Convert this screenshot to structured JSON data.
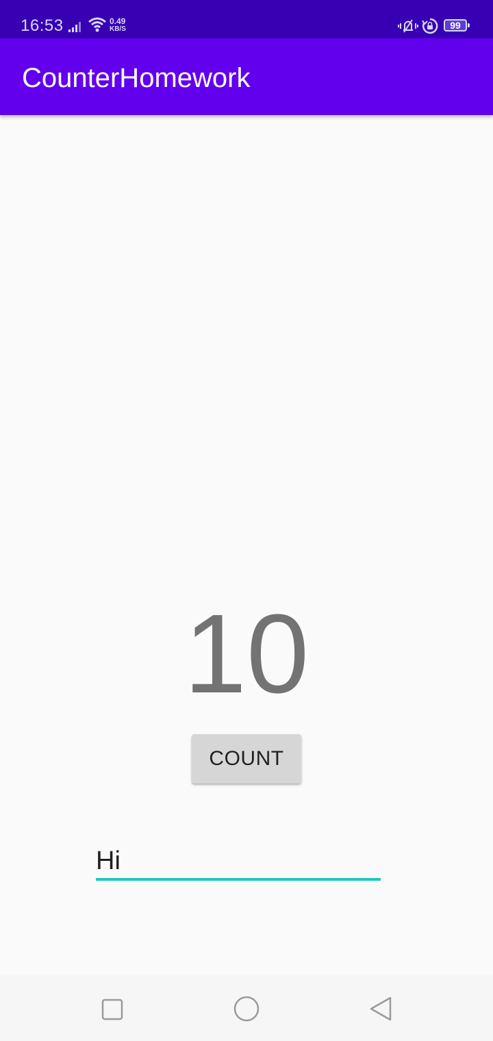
{
  "status_bar": {
    "time": "16:53",
    "net_speed_value": "0.49",
    "net_speed_unit": "KB/S",
    "battery_level": "99",
    "icons": [
      "signal-icon",
      "wifi-icon",
      "vibrate-icon",
      "rotation-lock-icon",
      "battery-icon"
    ],
    "background_color": "#3700b3"
  },
  "app_bar": {
    "title": "CounterHomework",
    "background_color": "#6200ee"
  },
  "main": {
    "count_value": "10",
    "count_button_label": "COUNT",
    "text_input_value": "Hi",
    "input_underline_color": "#1ec8c0"
  },
  "nav_bar": {
    "icons": [
      "recent-apps-icon",
      "home-icon",
      "back-icon"
    ]
  }
}
